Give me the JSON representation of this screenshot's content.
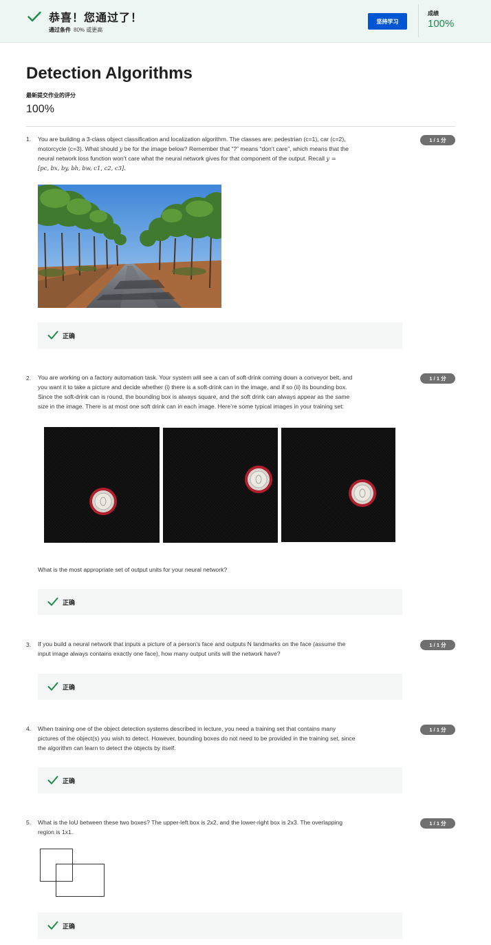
{
  "banner": {
    "title": "恭喜！您通过了！",
    "pass_condition_label": "通过条件",
    "pass_condition_value": "80% 或更高",
    "keep_learning_button": "坚持学习",
    "grade_label": "成绩",
    "grade_value": "100%",
    "accent_color": "#1e8a4a",
    "button_color": "#0056d2"
  },
  "header": {
    "title": "Detection Algorithms",
    "latest_submission_label": "最新提交作业的评分",
    "latest_submission_value": "100%"
  },
  "questions": [
    {
      "number": "1.",
      "text_line1": "You are building a 3-class object classification and localization algorithm. The classes are: pedestrian (c=1), car (c=2),",
      "text_line2a": "motorcycle (c=3). What should ",
      "text_line2_var": "y",
      "text_line2b": " be for the image below? Remember that “?” means “don’t care”, which means that the",
      "text_line3a": "neural network loss function won’t care what the neural network gives for that component of the output. Recall ",
      "text_line3_var": "y =",
      "text_line4": "[pc, bx, by, bh, bw, c1, c2, c3].",
      "score": "1 / 1 分",
      "feedback": "正确",
      "image": "tree-lined-road-photo"
    },
    {
      "number": "2.",
      "text_line1": "You are working on a factory automation task. Your system will see a can of soft-drink coming down a conveyor belt, and",
      "text_line2": "you want it to take a picture and decide whether (i) there is a soft-drink can in the image, and if so (ii) its bounding box.",
      "text_line3": "Since the soft-drink can is round, the bounding box is always square, and the soft drink can always appear as the same",
      "text_line4": "size in the image. There is at most one soft drink can in each image. Here’re some typical images in your training set:",
      "sub_question": "What is the most appropriate set of output units for your neural network?",
      "score": "1 / 1 分",
      "feedback": "正确",
      "image": "soft-drink-can-photos"
    },
    {
      "number": "3.",
      "text_line1": "If you build a neural network that inputs a picture of a person’s face and outputs N landmarks on the face (assume the",
      "text_line2": "input image always contains exactly one face), how many output units will the network have?",
      "score": "1 / 1 分",
      "feedback": "正确"
    },
    {
      "number": "4.",
      "text_line1": "When training one of the object detection systems described in lecture, you need a training set that contains many",
      "text_line2": "pictures of the object(s) you wish to detect. However, bounding boxes do not need to be provided in the training set, since",
      "text_line3": "the algorithm can learn to detect the objects by itself.",
      "score": "1 / 1 分",
      "feedback": "正确"
    },
    {
      "number": "5.",
      "text_line1": "What is the IoU between these two boxes? The upper-left box is 2x2, and the lower-right box is 2x3. The overlapping",
      "text_line2": "region is 1x1.",
      "score": "1 / 1 分",
      "feedback": "正确",
      "image": "two-overlapping-boxes-diagram"
    }
  ]
}
